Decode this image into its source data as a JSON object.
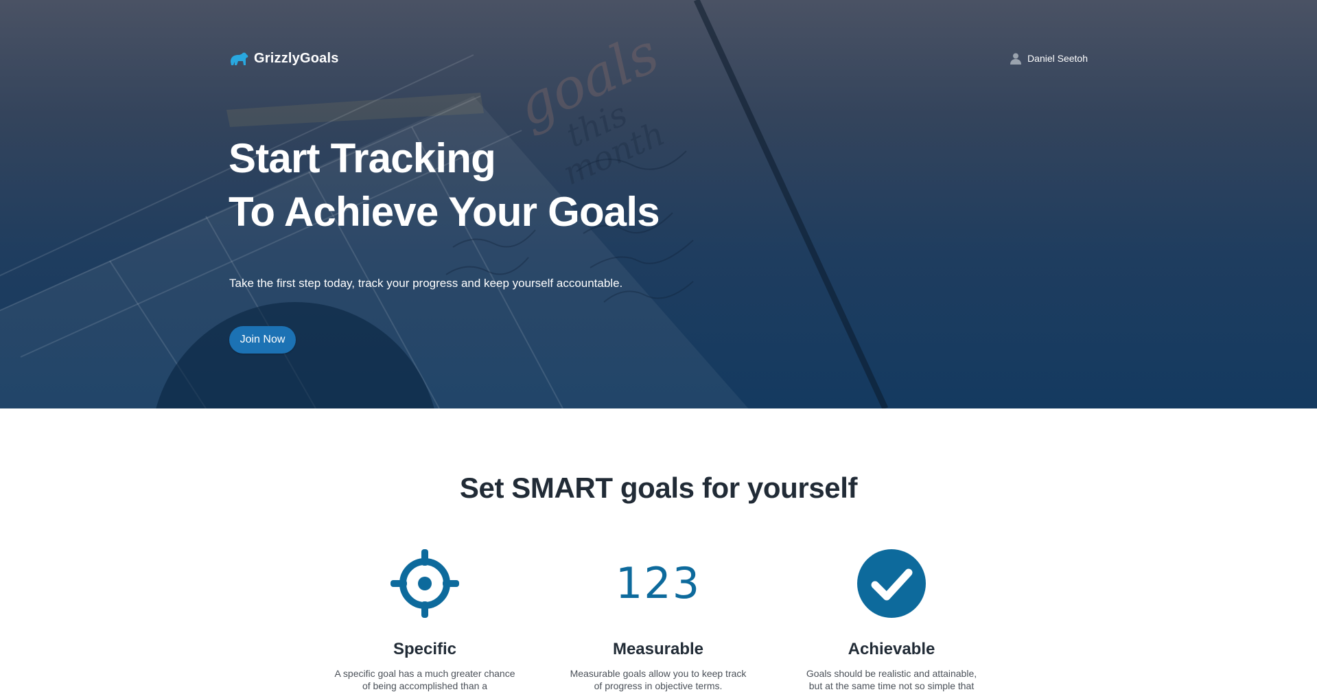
{
  "brand": {
    "name": "GrizzlyGoals",
    "logo_icon": "bear-icon",
    "color": "#29a8e0"
  },
  "user": {
    "name": "Daniel Seetoh",
    "icon": "user-icon"
  },
  "hero": {
    "title_line1": "Start Tracking",
    "title_line2": "To Achieve Your Goals",
    "subtitle": "Take the first step today, track your progress and keep yourself accountable.",
    "cta_label": "Join Now",
    "cta_color": "#1c72b4",
    "background_note_words": [
      "goals",
      "this",
      "month"
    ]
  },
  "smart": {
    "heading": "Set SMART goals for yourself",
    "accent_color": "#0d6a9c",
    "features": [
      {
        "title": "Specific",
        "icon": "crosshair-icon",
        "description": "A specific goal has a much greater chance of being accomplished than a"
      },
      {
        "title": "Measurable",
        "icon": "numbers-icon",
        "icon_text": "123",
        "description": "Measurable goals allow you to keep track of progress in objective terms."
      },
      {
        "title": "Achievable",
        "icon": "check-circle-icon",
        "description": "Goals should be realistic and attainable, but at the same time not so simple that"
      }
    ]
  }
}
